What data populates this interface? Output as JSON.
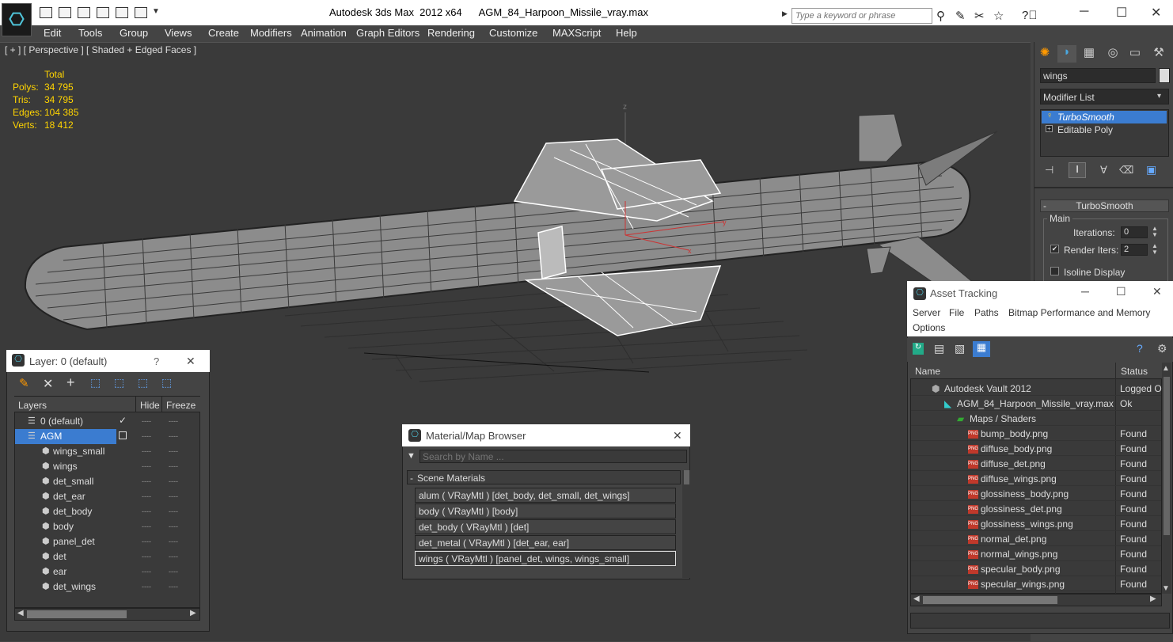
{
  "app": {
    "title": "Autodesk 3ds Max  2012 x64",
    "file": "AGM_84_Harpoon_Missile_vray.max",
    "search_placeholder": "Type a keyword or phrase"
  },
  "menu": [
    "Edit",
    "Tools",
    "Group",
    "Views",
    "Create",
    "Modifiers",
    "Animation",
    "Graph Editors",
    "Rendering",
    "Customize",
    "MAXScript",
    "Help"
  ],
  "viewport": {
    "label": "[ + ] [ Perspective ] [ Shaded + Edged Faces ]",
    "stats_header": "Total",
    "stats": [
      {
        "label": "Polys:",
        "value": "34 795"
      },
      {
        "label": "Tris:",
        "value": "34 795"
      },
      {
        "label": "Edges:",
        "value": "104 385"
      },
      {
        "label": "Verts:",
        "value": "18 412"
      }
    ],
    "axis_z": "z",
    "axis_x": "x",
    "axis_y": "y"
  },
  "command_panel": {
    "object_name": "wings",
    "modifier_list": "Modifier List",
    "stack": [
      "TurboSmooth",
      "Editable Poly"
    ],
    "rollout": "TurboSmooth",
    "group": "Main",
    "iterations_label": "Iterations:",
    "iterations": "0",
    "render_iters_label": "Render Iters:",
    "render_iters": "2",
    "isoline_label": "Isoline Display",
    "collapse": "-"
  },
  "layer_manager": {
    "title": "Layer: 0 (default)",
    "help": "?",
    "close": "✕",
    "col_layers": "Layers",
    "col_hide": "Hide",
    "col_freeze": "Freeze",
    "rows": [
      {
        "name": "0 (default)",
        "level": 0
      },
      {
        "name": "AGM",
        "level": 0
      },
      {
        "name": "wings_small",
        "level": 1
      },
      {
        "name": "wings",
        "level": 1
      },
      {
        "name": "det_small",
        "level": 1
      },
      {
        "name": "det_ear",
        "level": 1
      },
      {
        "name": "det_body",
        "level": 1
      },
      {
        "name": "body",
        "level": 1
      },
      {
        "name": "panel_det",
        "level": 1
      },
      {
        "name": "det",
        "level": 1
      },
      {
        "name": "ear",
        "level": 1
      },
      {
        "name": "det_wings",
        "level": 1
      }
    ],
    "dash": "----"
  },
  "material_browser": {
    "title": "Material/Map Browser",
    "search_placeholder": "Search by Name ...",
    "group": "Scene Materials",
    "group_toggle": "-",
    "close": "✕",
    "items": [
      "alum  ( VRayMtl ) [det_body, det_small, det_wings]",
      "body  ( VRayMtl ) [body]",
      "det_body  ( VRayMtl ) [det]",
      "det_metal  ( VRayMtl ) [det_ear, ear]",
      "wings  ( VRayMtl ) [panel_det, wings, wings_small]"
    ]
  },
  "asset_tracking": {
    "title": "Asset Tracking",
    "menu": [
      "Server",
      "File",
      "Paths",
      "Bitmap Performance and Memory",
      "Options"
    ],
    "col_name": "Name",
    "col_status": "Status",
    "vault": {
      "name": "Autodesk Vault 2012",
      "status": "Logged O"
    },
    "file": {
      "name": "AGM_84_Harpoon_Missile_vray.max",
      "status": "Ok"
    },
    "folder": "Maps / Shaders",
    "png_tag": "PNG",
    "maps": [
      {
        "name": "bump_body.png",
        "status": "Found"
      },
      {
        "name": "diffuse_body.png",
        "status": "Found"
      },
      {
        "name": "diffuse_det.png",
        "status": "Found"
      },
      {
        "name": "diffuse_wings.png",
        "status": "Found"
      },
      {
        "name": "glossiness_body.png",
        "status": "Found"
      },
      {
        "name": "glossiness_det.png",
        "status": "Found"
      },
      {
        "name": "glossiness_wings.png",
        "status": "Found"
      },
      {
        "name": "normal_det.png",
        "status": "Found"
      },
      {
        "name": "normal_wings.png",
        "status": "Found"
      },
      {
        "name": "specular_body.png",
        "status": "Found"
      },
      {
        "name": "specular_wings.png",
        "status": "Found"
      }
    ]
  }
}
